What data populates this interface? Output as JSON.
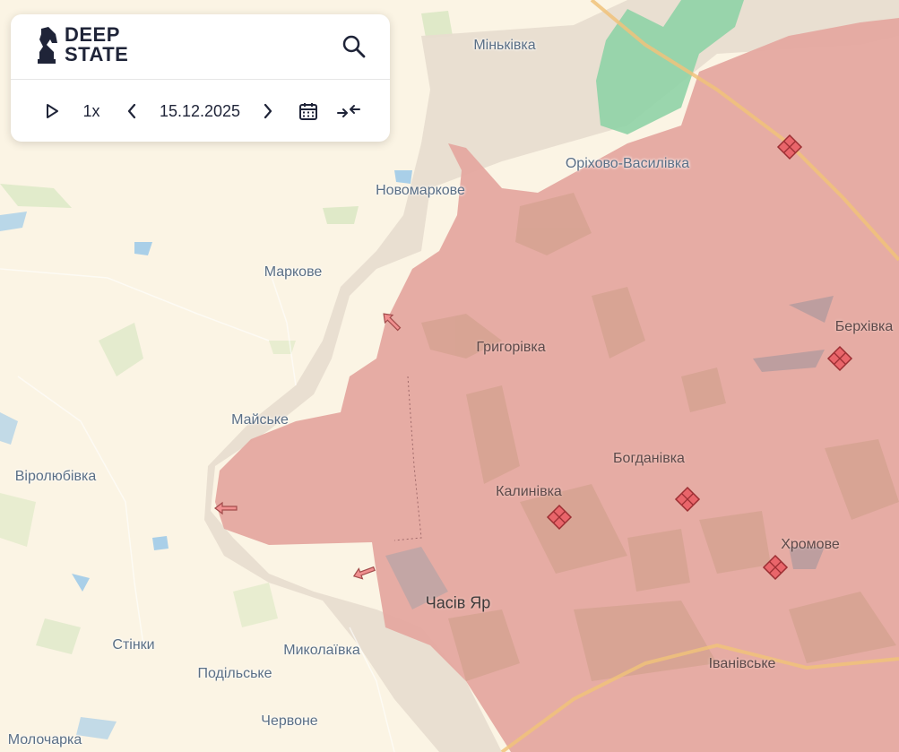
{
  "app": {
    "logo_text_line1": "DEEP",
    "logo_text_line2": "STATE",
    "icons": {
      "logo": "knight-chess-icon",
      "search": "search-icon",
      "play": "play-icon",
      "prev": "chevron-left-icon",
      "next": "chevron-right-icon",
      "calendar": "calendar-icon",
      "compare": "compare-arrows-icon"
    }
  },
  "timeline": {
    "speed": "1x",
    "date": "15.12.2025"
  },
  "colors": {
    "background": "#fbf4e4",
    "occupied": "#e5a8a0",
    "contested": "#e8ddd0",
    "forest": "#8fd3a6",
    "road": "#f0c27a",
    "water": "#a9cfe8",
    "label": "#5a6f86",
    "marker": "#e9656a"
  },
  "map": {
    "places": [
      {
        "name": "Міньківка",
        "type": "free"
      },
      {
        "name": "Оріхово-Василівка",
        "type": "free"
      },
      {
        "name": "Новомаркове",
        "type": "free"
      },
      {
        "name": "Маркове",
        "type": "free"
      },
      {
        "name": "Майське",
        "type": "free"
      },
      {
        "name": "Віролюбівка",
        "type": "free"
      },
      {
        "name": "Стінки",
        "type": "free"
      },
      {
        "name": "Миколаївка",
        "type": "free"
      },
      {
        "name": "Подільське",
        "type": "free"
      },
      {
        "name": "Червоне",
        "type": "free"
      },
      {
        "name": "Молочарка",
        "type": "free"
      },
      {
        "name": "Григорівка",
        "type": "occupied"
      },
      {
        "name": "Берхівка",
        "type": "occupied"
      },
      {
        "name": "Богданівка",
        "type": "occupied"
      },
      {
        "name": "Калинівка",
        "type": "occupied"
      },
      {
        "name": "Хромове",
        "type": "occupied"
      },
      {
        "name": "Часів Яр",
        "type": "occupied"
      },
      {
        "name": "Іванівське",
        "type": "occupied"
      }
    ]
  }
}
